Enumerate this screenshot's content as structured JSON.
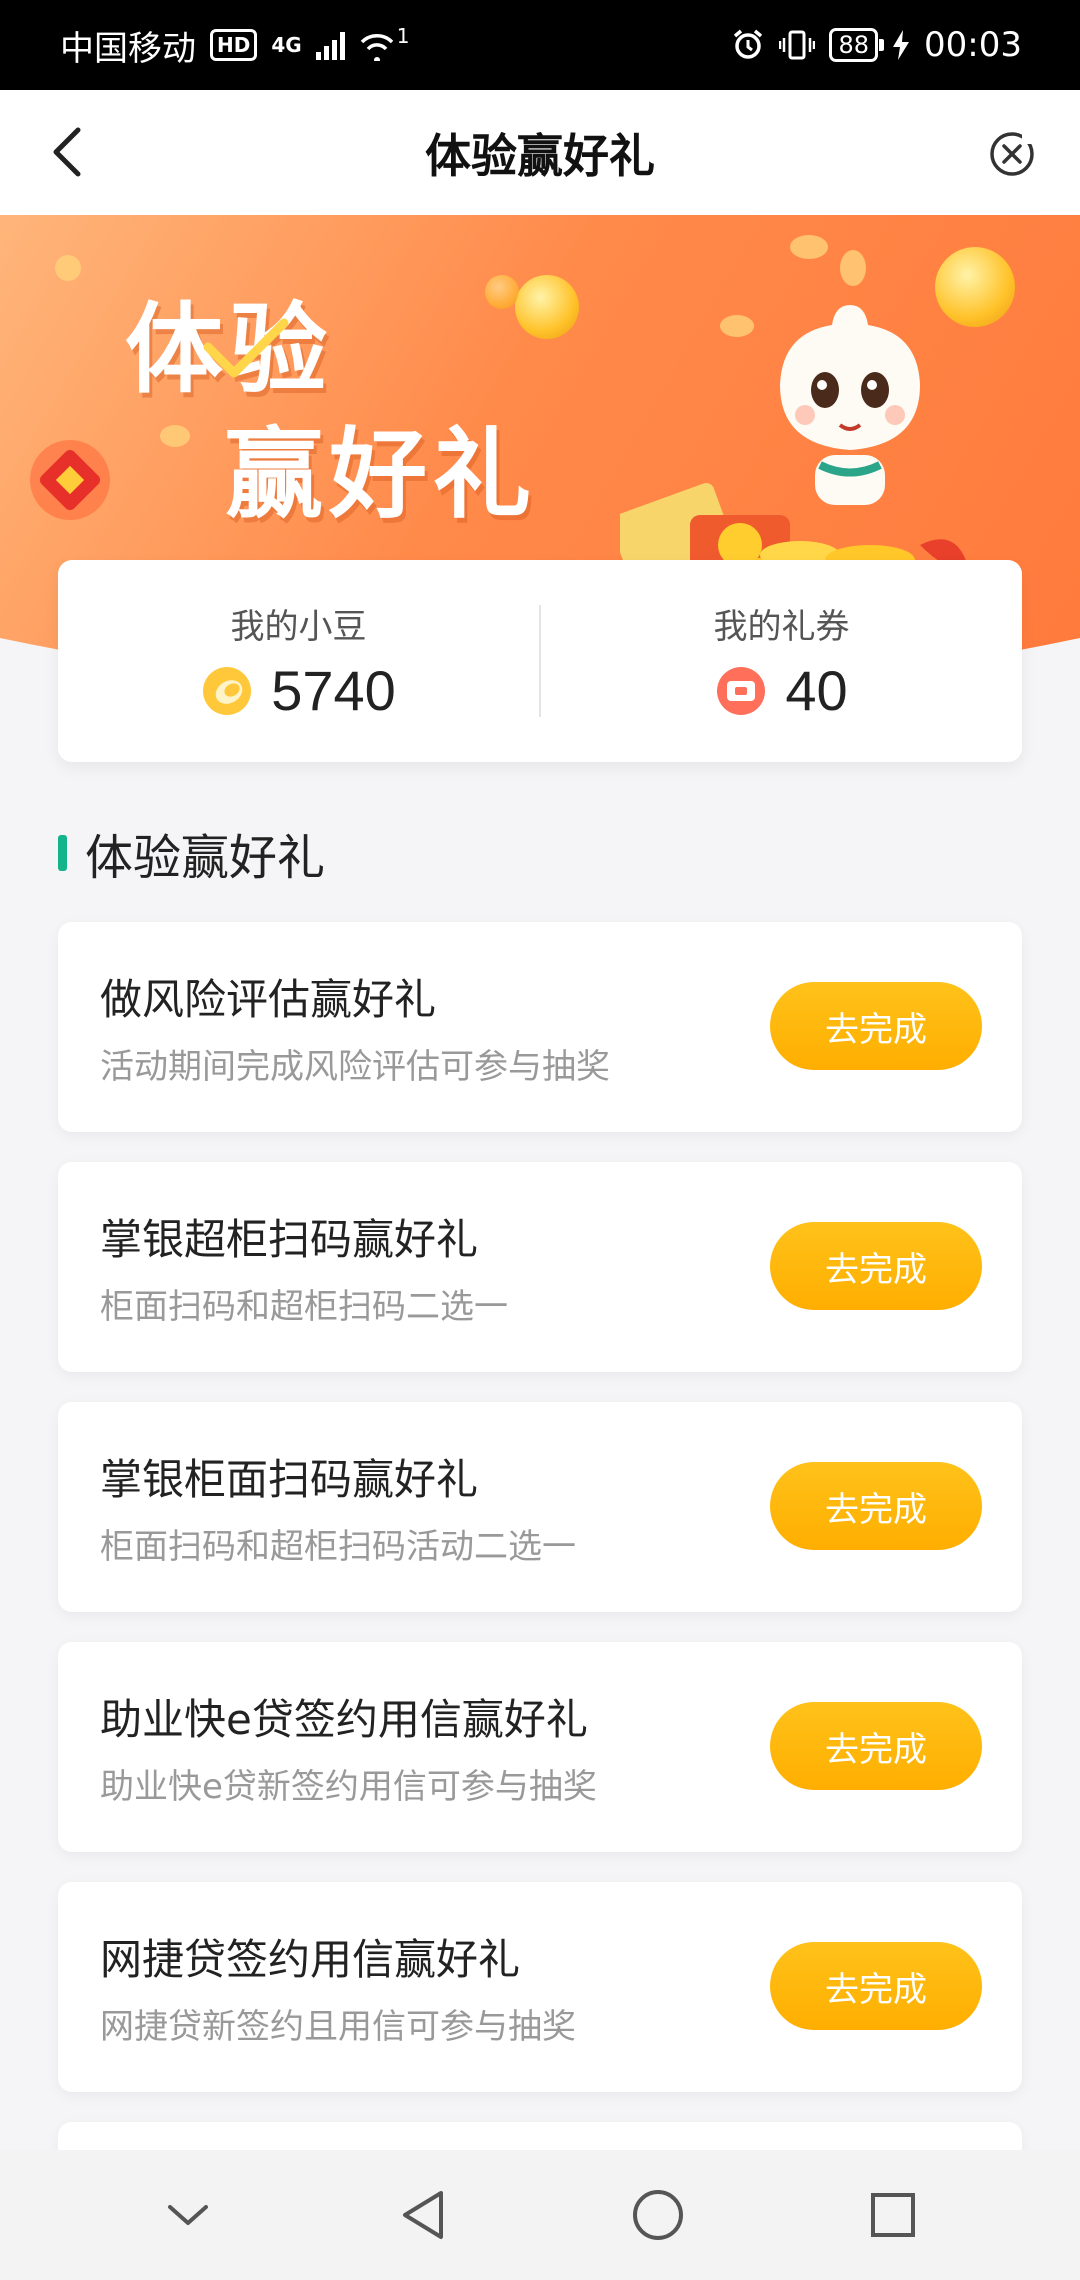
{
  "status_bar": {
    "carrier": "中国移动",
    "hd": "HD",
    "network": "4G",
    "wifi_badge": "1",
    "battery": "88",
    "time": "00:03"
  },
  "nav": {
    "title": "体验赢好礼"
  },
  "banner": {
    "title_line1": "体验",
    "title_line2": "赢好礼"
  },
  "stats": {
    "beans_label": "我的小豆",
    "beans_value": "5740",
    "coupons_label": "我的礼券",
    "coupons_value": "40"
  },
  "section": {
    "title": "体验赢好礼"
  },
  "tasks": [
    {
      "title": "做风险评估赢好礼",
      "desc": "活动期间完成风险评估可参与抽奖",
      "button": "去完成"
    },
    {
      "title": "掌银超柜扫码赢好礼",
      "desc": "柜面扫码和超柜扫码二选一",
      "button": "去完成"
    },
    {
      "title": "掌银柜面扫码赢好礼",
      "desc": "柜面扫码和超柜扫码活动二选一",
      "button": "去完成"
    },
    {
      "title": "助业快e贷签约用信赢好礼",
      "desc": "助业快e贷新签约用信可参与抽奖",
      "button": "去完成"
    },
    {
      "title": "网捷贷签约用信赢好礼",
      "desc": "网捷贷新签约且用信可参与抽奖",
      "button": "去完成"
    }
  ],
  "colors": {
    "accent_green": "#13b48a",
    "button_orange": "#ffb300",
    "banner_orange": "#ff8a4a"
  },
  "icons": {
    "back": "chevron-left-icon",
    "close": "close-circle-icon",
    "beans": "bean-coin-icon",
    "coupons": "coupon-icon"
  }
}
